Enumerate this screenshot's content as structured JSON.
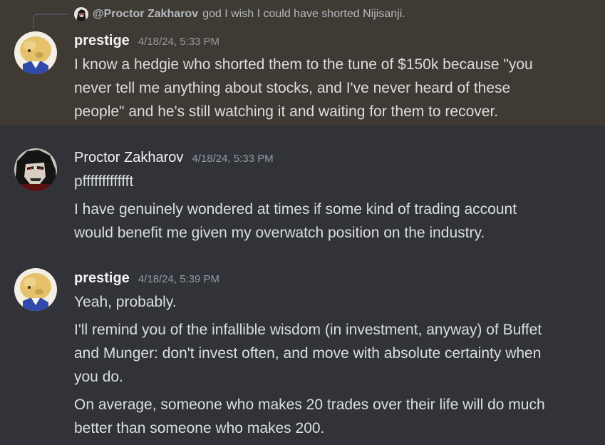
{
  "reply": {
    "mention": "@Proctor Zakharov",
    "text": "god I wish I could have shorted Nijisanji."
  },
  "messages": [
    {
      "author": "prestige",
      "timestamp": "4/18/24, 5:33 PM",
      "lines": [
        "I know a hedgie who shorted them to the tune of $150k because \"you",
        "never tell me anything about stocks, and I've never heard of these",
        "people\" and he's still watching it and waiting for them to recover."
      ]
    },
    {
      "author": "Proctor Zakharov",
      "timestamp": "4/18/24, 5:33 PM",
      "lines": [
        "pfffffffffffft",
        "I have genuinely wondered at times if some kind of trading account",
        "would benefit me given my overwatch position on the industry."
      ]
    },
    {
      "author": "prestige",
      "timestamp": "4/18/24, 5:39 PM",
      "lines": [
        "Yeah, probably.",
        "I'll remind you of the infallible wisdom (in investment, anyway) of Buffet",
        "and Munger: don't invest often, and move with absolute certainty when",
        "you do.",
        "On average, someone who makes 20 trades over their life will do much",
        "better than someone who makes 200."
      ]
    }
  ]
}
